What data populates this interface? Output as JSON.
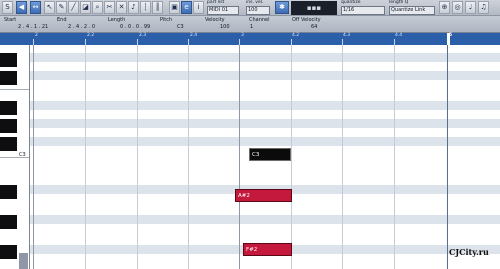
{
  "toolbar": {
    "part_list_label": "part list",
    "part_list_value": "MIDI 01",
    "ins_vel_label": "ins. vel.",
    "ins_vel_value": "100",
    "quantize_label": "quantize",
    "quantize_value": "1/16",
    "length_label": "length Q",
    "length_value": "Quantize Link"
  },
  "infoline": {
    "headers": [
      "Start",
      "End",
      "Length",
      "Pitch",
      "Velocity",
      "Channel",
      "Off Velocity"
    ],
    "values": [
      "2 . 4 . 1 . 21",
      "2 . 4 . 2 . 0",
      "0 . 0 . 0 . 99",
      "C3",
      "100",
      "1",
      "64"
    ]
  },
  "ruler": {
    "labels": [
      "2",
      "2.2",
      "2.3",
      "2.4",
      "3",
      "4.2",
      "4.3",
      "4.4",
      "5"
    ]
  },
  "keyboard": {
    "c3_label": "C3"
  },
  "notes": [
    {
      "name": "C3",
      "selected": true
    },
    {
      "name": "A#2",
      "selected": false
    },
    {
      "name": "F#2",
      "selected": false
    }
  ],
  "watermark": "CJCity.ru",
  "colors": {
    "ruler": "#2c5faa",
    "note": "#c4183c",
    "selected_note": "#0b0b0b",
    "toolbar_accent": "#3e6cb4"
  }
}
